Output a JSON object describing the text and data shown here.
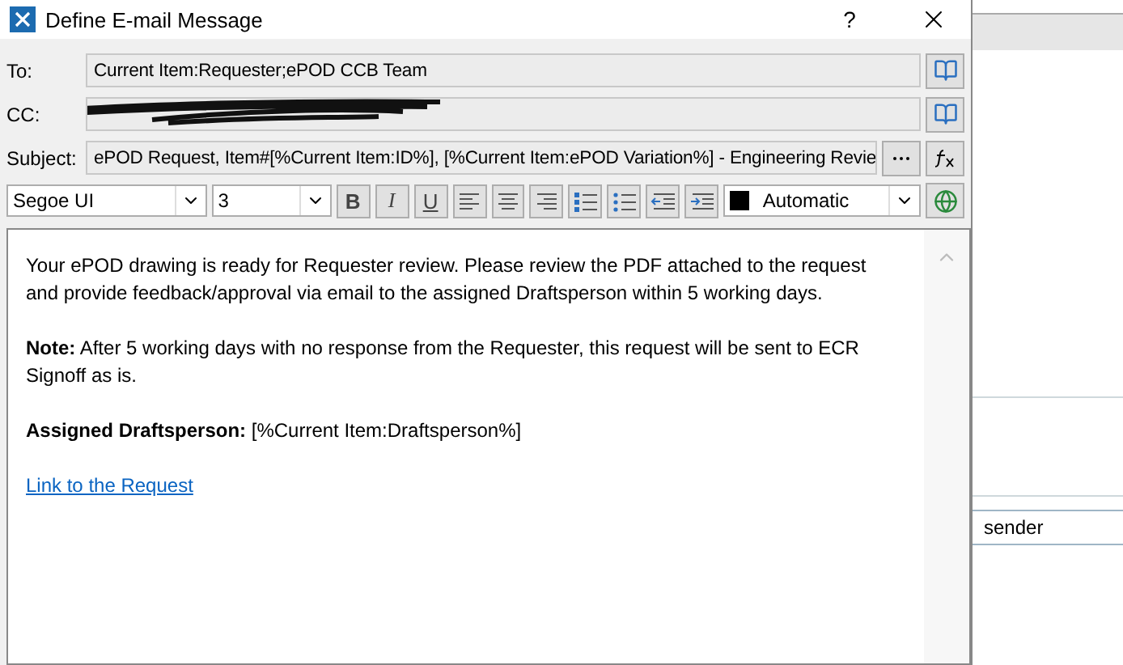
{
  "window": {
    "title": "Define E-mail Message",
    "help": "?"
  },
  "fields": [
    {
      "label": "To:",
      "value": "Current Item:Requester;ePOD CCB Team",
      "redacted": false,
      "kind": "address"
    },
    {
      "label": "CC:",
      "redacted": true,
      "kind": "address"
    },
    {
      "label": "Subject:",
      "value": "ePOD Request, Item#[%Current Item:ID%], [%Current Item:ePOD Variation%] - Engineering Revie",
      "redacted": false,
      "kind": "subject"
    }
  ],
  "toolbar": {
    "font": "Segoe UI",
    "size": "3",
    "color_label": "Automatic",
    "color": "#000000",
    "buttons": [
      {
        "kind": "bold",
        "label": "B"
      },
      {
        "kind": "italic",
        "label": "I"
      },
      {
        "kind": "underline",
        "label": "U"
      },
      {
        "kind": "align-left"
      },
      {
        "kind": "align-center"
      },
      {
        "kind": "align-right"
      },
      {
        "kind": "numbered-list"
      },
      {
        "kind": "bullet-list"
      },
      {
        "kind": "outdent"
      },
      {
        "kind": "indent"
      }
    ]
  },
  "body": {
    "paragraphs": [
      "Your ePOD drawing is ready for Requester review. Please review the PDF attached to the request and provide feedback/approval via email to the assigned Draftsperson within 5 working days.",
      "**Note:** After 5 working days with no response from the Requester, this request will be sent to ECR Signoff as is.",
      "**Assigned Draftsperson:** [%Current Item:Draftsperson%]"
    ],
    "link": "Link to the Request"
  },
  "background": {
    "row_text": "sender"
  }
}
